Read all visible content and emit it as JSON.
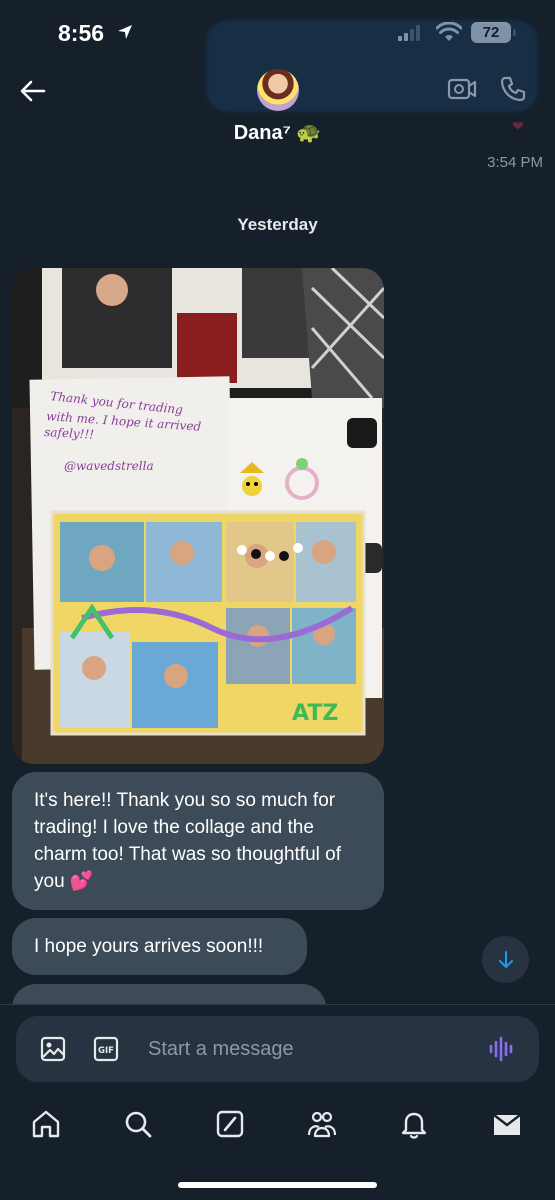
{
  "status_bar": {
    "time": "8:56",
    "battery": "72"
  },
  "header": {
    "contact_name": "Dana⁷ 🐢",
    "previous_message_time": "3:54 PM"
  },
  "conversation": {
    "day_separator": "Yesterday",
    "photo": {
      "note_text": "Thank you for trading with me. I hope it arrived safely!!!",
      "note_handle": "@wavedstrella"
    },
    "messages": [
      {
        "text": "It's here!!  Thank you so so much for trading!  I love the collage and the charm too!  That was so thoughtful of you 💕"
      },
      {
        "text": "I hope yours arrives soon!!!"
      },
      {
        "text": ""
      }
    ]
  },
  "composer": {
    "placeholder": "Start a message"
  },
  "tabs": [
    "Home",
    "Search",
    "Grok",
    "Communities",
    "Notifications",
    "Messages"
  ],
  "icons": [
    "location-arrow-icon",
    "cellular-signal-icon",
    "wifi-icon",
    "battery-icon",
    "back-arrow-icon",
    "video-call-icon",
    "phone-icon",
    "arrow-down-icon",
    "image-icon",
    "gif-icon",
    "voice-icon",
    "home-icon",
    "search-icon",
    "grok-icon",
    "communities-icon",
    "bell-icon",
    "mail-icon"
  ],
  "colors": {
    "background": "#15202b",
    "bubble": "#3d4a58",
    "accent": "#1d9bf0",
    "voice": "#8b6cf0"
  }
}
